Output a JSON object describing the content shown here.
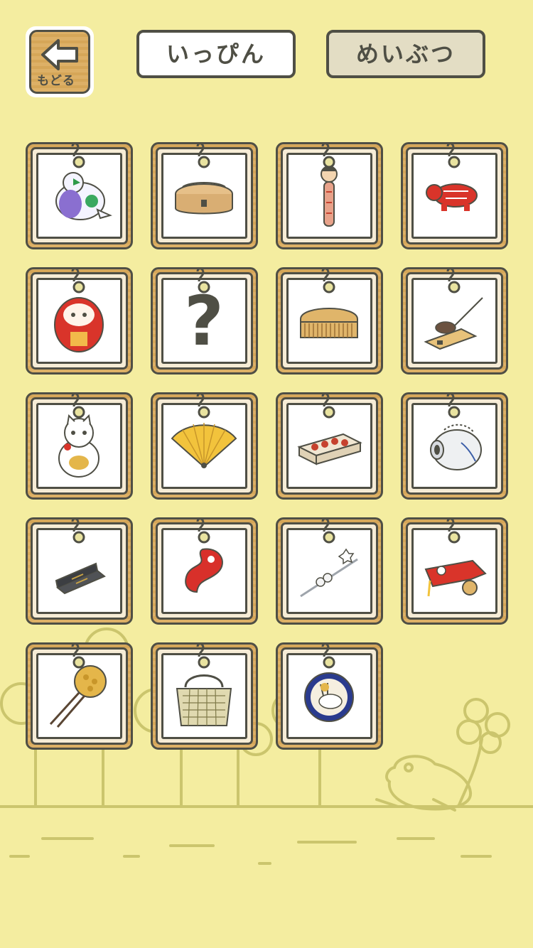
{
  "header": {
    "back_label": "もどる",
    "tab_ippin": "いっぴん",
    "tab_meibutsu": "めいぶつ"
  },
  "colors": {
    "background": "#f4eda0",
    "ink": "#4f4f45",
    "wood": "#ddb066",
    "scenery": "#cbc56d"
  },
  "items": [
    {
      "icon": "pigeon-whistle-icon"
    },
    {
      "icon": "wooden-lunchbox-icon"
    },
    {
      "icon": "kokeshi-doll-icon"
    },
    {
      "icon": "akabeko-ox-icon"
    },
    {
      "icon": "daruma-doll-icon"
    },
    {
      "icon": "unknown-item-icon",
      "text": "?"
    },
    {
      "icon": "boxwood-comb-icon"
    },
    {
      "icon": "mousetrap-icon"
    },
    {
      "icon": "maneki-neko-icon"
    },
    {
      "icon": "folding-fan-icon"
    },
    {
      "icon": "box-of-sweets-icon"
    },
    {
      "icon": "pig-mosquito-coil-icon"
    },
    {
      "icon": "ink-stick-icon"
    },
    {
      "icon": "magatama-bead-icon"
    },
    {
      "icon": "flower-hairpin-icon"
    },
    {
      "icon": "fish-cart-toy-icon"
    },
    {
      "icon": "kanzashi-hairpin-icon"
    },
    {
      "icon": "woven-basket-bag-icon"
    },
    {
      "icon": "rabbit-plate-icon"
    }
  ]
}
